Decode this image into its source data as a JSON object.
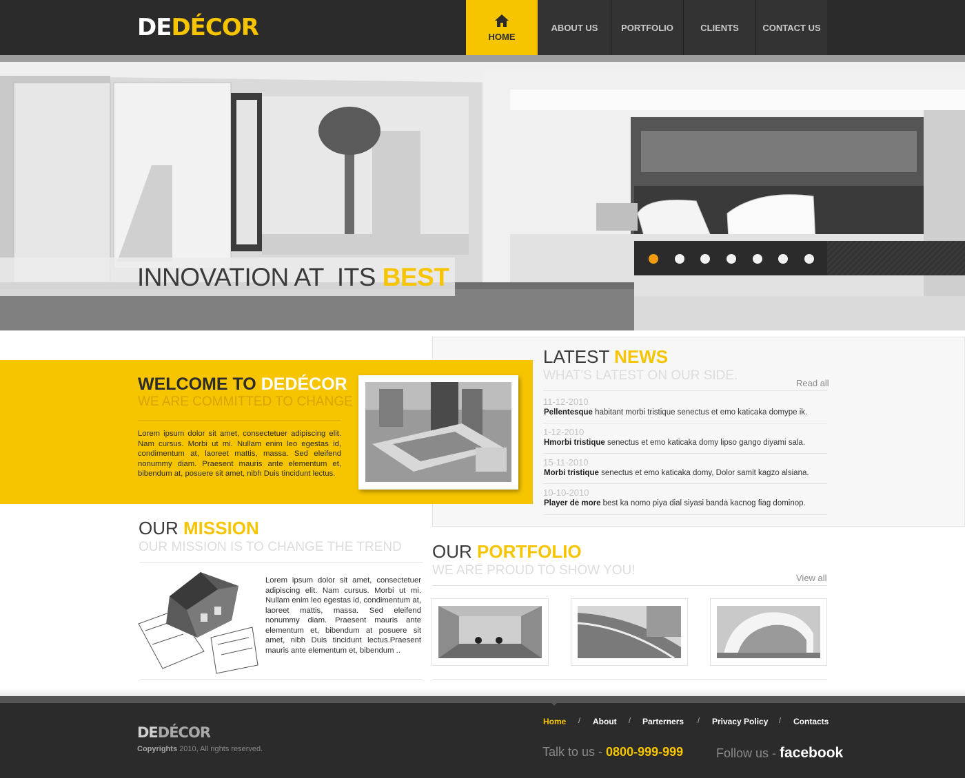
{
  "brand": {
    "logo_part1": "DE",
    "logo_part2": "DÉCOR"
  },
  "nav": {
    "home": "HOME",
    "about": "ABOUT US",
    "portfolio": "PORTFOLIO",
    "clients": "CLIENTS",
    "contact": "CONTACT US"
  },
  "hero": {
    "caption_prefix": "INNOVATION AT  ITS ",
    "caption_highlight": "BEST",
    "slide_count": 7,
    "active_slide": 1
  },
  "welcome": {
    "title_part1": "WELCOME TO ",
    "title_part2": "DEDÉCOR",
    "subtitle": "WE ARE COMMITTED TO CHANGE",
    "text": "Lorem ipsum dolor sit amet, consectetuer adipiscing elit. Nam cursus. Morbi ut mi. Nullam enim leo egestas id, condimentum at, laoreet mattis, massa. Sed eleifend nonummy diam. Praesent mauris ante elementum et, bibendum at, posuere sit amet, nibh Duis tincidunt lectus."
  },
  "news": {
    "title_part1": "LATEST ",
    "title_part2": "NEWS",
    "subtitle": "WHAT'S LATEST ON OUR SIDE.",
    "read_all": "Read all",
    "items": [
      {
        "date": "11-12-2010",
        "bold": "Pellentesque",
        "text": " habitant morbi tristique senectus et emo katicaka domype ik."
      },
      {
        "date": "1-12-2010",
        "bold": "Hmorbi tristique",
        "text": " senectus et emo katicaka domy lipso gango diyami sala."
      },
      {
        "date": "15-11-2010",
        "bold": "Morbi tristique",
        "text": " senectus et emo katicaka domy, Dolor samit kagzo alsiana."
      },
      {
        "date": "10-10-2010",
        "bold": "Player de more",
        "text": " best ka nomo piya dial siyasi banda kacnog fiag dominop."
      }
    ]
  },
  "mission": {
    "title_part1": "OUR ",
    "title_part2": "MISSION",
    "subtitle": "OUR MISSION IS TO CHANGE THE TREND",
    "text": "Lorem ipsum dolor sit amet, consectetuer adipiscing elit. Nam cursus. Morbi ut mi. Nullam enim leo egestas id, condimentum at, laoreet mattis, massa. Sed eleifend nonummy diam. Praesent mauris ante elementum et, bibendum at posuere sit amet, nibh Duis tincidunt lectus.Praesent mauris ante elementum et, bibendum .."
  },
  "portfolio": {
    "title_part1": "OUR ",
    "title_part2": "PORTFOLIO",
    "subtitle": "WE ARE PROUD TO SHOW YOU!",
    "view_all": "View all"
  },
  "footer": {
    "logo_part1": "DE",
    "logo_part2": "DÉCOR",
    "copyright_bold": "Copyrights",
    "copyright_rest": " 2010, All rights reserved.",
    "links": [
      "Home",
      "About",
      "Parterners",
      "Privacy Policy",
      "Contacts"
    ],
    "separator": "/",
    "talk_label": "Talk to us - ",
    "phone": "0800-999-999",
    "follow_label": "Follow us - ",
    "facebook": "facebook"
  },
  "colors": {
    "accent": "#f6c500",
    "dark": "#2b2b2b",
    "slider_active": "#f39c12"
  }
}
